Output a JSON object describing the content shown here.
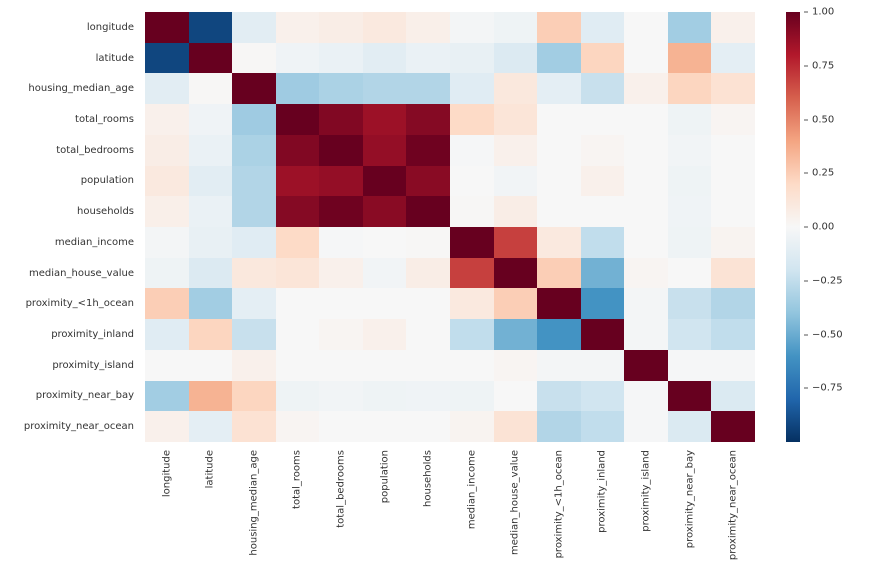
{
  "chart_data": {
    "type": "heatmap",
    "labels": [
      "longitude",
      "latitude",
      "housing_median_age",
      "total_rooms",
      "total_bedrooms",
      "population",
      "households",
      "median_income",
      "median_house_value",
      "proximity_<1h_ocean",
      "proximity_inland",
      "proximity_island",
      "proximity_near_bay",
      "proximity_near_ocean"
    ],
    "matrix": [
      [
        1.0,
        -0.92,
        -0.11,
        0.05,
        0.07,
        0.1,
        0.06,
        -0.02,
        -0.05,
        0.25,
        -0.12,
        0.0,
        -0.35,
        0.05
      ],
      [
        -0.92,
        1.0,
        0.01,
        -0.04,
        -0.07,
        -0.11,
        -0.07,
        -0.08,
        -0.14,
        -0.35,
        0.22,
        0.0,
        0.35,
        -0.1
      ],
      [
        -0.11,
        0.01,
        1.0,
        -0.36,
        -0.32,
        -0.3,
        -0.3,
        -0.12,
        0.11,
        -0.1,
        -0.23,
        0.05,
        0.22,
        0.15
      ],
      [
        0.05,
        -0.04,
        -0.36,
        1.0,
        0.93,
        0.86,
        0.92,
        0.2,
        0.13,
        0.0,
        0.0,
        0.0,
        -0.05,
        0.02
      ],
      [
        0.07,
        -0.07,
        -0.32,
        0.93,
        1.0,
        0.88,
        0.98,
        -0.01,
        0.05,
        0.0,
        0.02,
        0.0,
        -0.03,
        0.0
      ],
      [
        0.1,
        -0.11,
        -0.3,
        0.86,
        0.88,
        1.0,
        0.91,
        0.0,
        -0.03,
        0.0,
        0.05,
        0.0,
        -0.05,
        0.0
      ],
      [
        0.06,
        -0.07,
        -0.3,
        0.92,
        0.98,
        0.91,
        1.0,
        0.01,
        0.07,
        0.0,
        0.0,
        0.0,
        -0.04,
        0.0
      ],
      [
        -0.02,
        -0.08,
        -0.12,
        0.2,
        -0.01,
        0.0,
        0.01,
        1.0,
        0.69,
        0.1,
        -0.25,
        0.0,
        -0.05,
        0.03
      ],
      [
        -0.05,
        -0.14,
        0.11,
        0.13,
        0.05,
        -0.03,
        0.07,
        0.69,
        1.0,
        0.25,
        -0.48,
        0.02,
        0.0,
        0.14
      ],
      [
        0.25,
        -0.35,
        -0.1,
        0.0,
        0.0,
        0.0,
        0.0,
        0.1,
        0.25,
        1.0,
        -0.6,
        -0.02,
        -0.23,
        -0.3
      ],
      [
        -0.12,
        0.22,
        -0.23,
        0.0,
        0.02,
        0.05,
        0.0,
        -0.25,
        -0.48,
        -0.6,
        1.0,
        -0.02,
        -0.2,
        -0.25
      ],
      [
        0.0,
        0.0,
        0.05,
        0.0,
        0.0,
        0.0,
        0.0,
        0.0,
        0.02,
        -0.02,
        -0.02,
        1.0,
        -0.01,
        -0.01
      ],
      [
        -0.35,
        0.35,
        0.22,
        -0.05,
        -0.03,
        -0.05,
        -0.04,
        -0.05,
        0.0,
        -0.23,
        -0.2,
        -0.01,
        1.0,
        -0.15
      ],
      [
        0.05,
        -0.1,
        0.15,
        0.02,
        0.0,
        0.0,
        0.0,
        0.03,
        0.14,
        -0.3,
        -0.25,
        -0.01,
        -0.15,
        1.0
      ]
    ],
    "colorbar": {
      "vmin": -1.0,
      "vmax": 1.0,
      "ticks": [
        -0.75,
        -0.5,
        -0.25,
        0.0,
        0.25,
        0.5,
        0.75,
        1.0
      ],
      "tick_labels": [
        "−0.75",
        "−0.50",
        "−0.25",
        "0.00",
        "0.25",
        "0.50",
        "0.75",
        "1.00"
      ]
    },
    "cmap_stops": [
      [
        -1.0,
        "#053061"
      ],
      [
        -0.8,
        "#2166ac"
      ],
      [
        -0.6,
        "#4393c3"
      ],
      [
        -0.4,
        "#92c5de"
      ],
      [
        -0.2,
        "#d1e5f0"
      ],
      [
        0.0,
        "#f7f7f7"
      ],
      [
        0.2,
        "#fddbc7"
      ],
      [
        0.4,
        "#f4a582"
      ],
      [
        0.6,
        "#d6604d"
      ],
      [
        0.8,
        "#b2182b"
      ],
      [
        1.0,
        "#67001f"
      ]
    ]
  }
}
